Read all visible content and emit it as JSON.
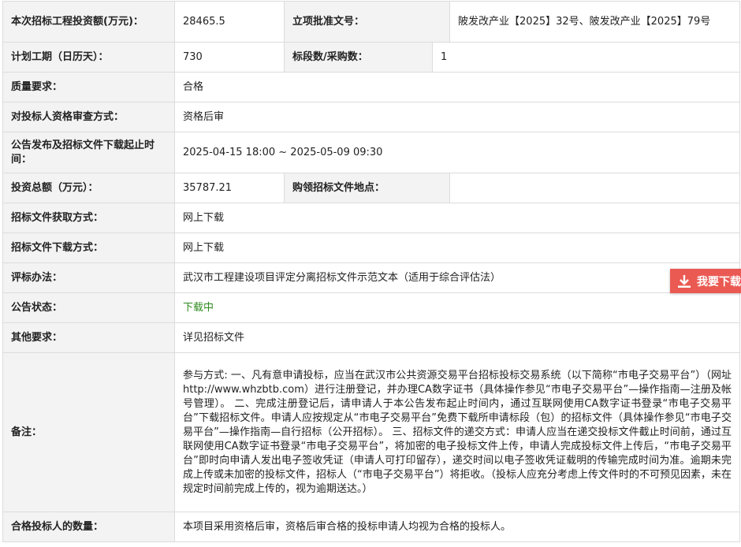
{
  "rows": {
    "investment": {
      "label": "本次招标工程投资额(万元)：",
      "value": "28465.5"
    },
    "approval": {
      "label": "立项批准文号：",
      "value": "陂发改产业【2025】32号、陂发改产业【2025】79号"
    },
    "period": {
      "label": "计划工期（日历天）：",
      "value": "730"
    },
    "sections": {
      "label": "标段数/采购数：",
      "value": "1"
    },
    "quality": {
      "label": "质量要求：",
      "value": "合格"
    },
    "qualification_review": {
      "label": "对投标人资格审查方式：",
      "value": "资格后审"
    },
    "announce_time": {
      "label": "公告发布及招标文件下载起止时间：",
      "value": "2025-04-15 18:00 ~ 2025-05-09 09:30"
    },
    "total_investment": {
      "label": "投资总额（万元）：",
      "value": "35787.21"
    },
    "purchase_location": {
      "label": "购领招标文件地点：",
      "value": ""
    },
    "obtain_method": {
      "label": "招标文件获取方式：",
      "value": "网上下载"
    },
    "download_method": {
      "label": "招标文件下载方式：",
      "value": "网上下载"
    },
    "evaluation": {
      "label": "评标办法：",
      "value": "武汉市工程建设项目评定分离招标文件示范文本（适用于综合评估法）"
    },
    "status": {
      "label": "公告状态：",
      "value": "下载中"
    },
    "other": {
      "label": "其他要求：",
      "value": "详见招标文件"
    },
    "remark": {
      "label": "备注：",
      "value": "参与方式: 一、凡有意申请投标，应当在武汉市公共资源交易平台招标投标交易系统（以下简称“市电子交易平台”）（网址http://www.whzbtb.com）进行注册登记，并办理CA数字证书（具体操作参见“市电子交易平台”—操作指南—注册及帐号管理）。 二、完成注册登记后，请申请人于本公告发布起止时间内，通过互联网使用CA数字证书登录“市电子交易平台”下载招标文件。申请人应按规定从“市电子交易平台”免费下载所申请标段（包）的招标文件（具体操作参见“市电子交易平台”—操作指南—自行招标（公开招标）。 三、招标文件的递交方式：申请人应当在递交投标文件截止时间前，通过互联网使用CA数字证书登录“市电子交易平台”，将加密的电子投标文件上传，申请人完成投标文件上传后，“市电子交易平台”即时向申请人发出电子签收凭证（申请人可打印留存），递交时间以电子签收凭证载明的传输完成时间为准。逾期未完成上传或未加密的投标文件，招标人（“市电子交易平台”）将拒收。（投标人应充分考虑上传文件时的不可预见因素，未在规定时间前完成上传的，视为逾期送达。）"
    },
    "qualified_count": {
      "label": "合格投标人的数量：",
      "value": "本项目采用资格后审，资格后审合格的投标申请人均视为合格的投标人。"
    }
  },
  "download_button": {
    "label": "我要下载",
    "icon": "download-icon",
    "color": "#ea5a53"
  },
  "colors": {
    "status_green": "#2e8b1e",
    "label_bg": "#f3f3f3",
    "border": "#dcdcdc"
  }
}
